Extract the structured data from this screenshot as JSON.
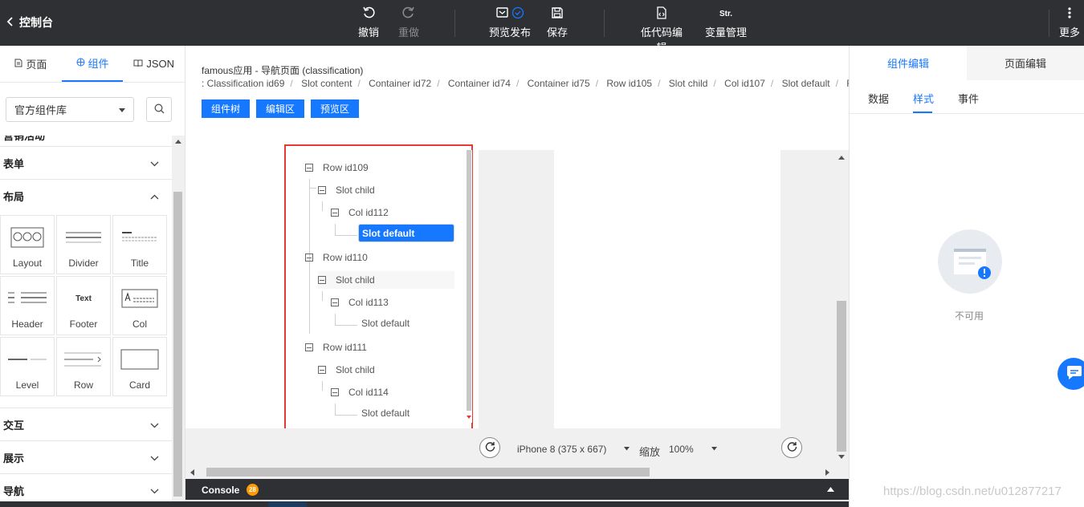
{
  "topbar": {
    "back_label": "控制台",
    "undo": "撤销",
    "redo": "重做",
    "preview_publish": "预览发布",
    "save": "保存",
    "lowcode": "低代码编辑",
    "variables": "变量管理",
    "variables_icon_text": "Str.",
    "more": "更多"
  },
  "left": {
    "tabs": {
      "page": "页面",
      "components": "组件",
      "json": "JSON"
    },
    "library_select": "官方组件库",
    "partial_group": "营销活动",
    "groups": {
      "form": "表单",
      "layout": "布局",
      "interaction": "交互",
      "display": "展示",
      "navigation": "导航"
    },
    "components": [
      "Layout",
      "Divider",
      "Title",
      "Header",
      "Footer",
      "Col",
      "Level",
      "Row",
      "Card"
    ],
    "footer_thumb_text": "Text"
  },
  "center": {
    "page_title": "famous应用 - 导航页面 (classification)",
    "breadcrumb": [
      ": Classification id69",
      "Slot content",
      "Container id72",
      "Container id74",
      "Container id75",
      "Row id105",
      "Slot child",
      "Col id107",
      "Slot default",
      "R"
    ],
    "buttons": {
      "tree": "组件树",
      "edit": "编辑区",
      "preview": "预览区"
    },
    "tree": {
      "rows": [
        "Row id109",
        "Row id110",
        "Row id111"
      ],
      "slot_child": "Slot child",
      "cols": [
        "Col id112",
        "Col id113",
        "Col id114"
      ],
      "slot_default": "Slot default"
    },
    "device": "iPhone 8 (375 x 667)",
    "zoom_label": "缩放",
    "zoom_value": "100%"
  },
  "console": {
    "label": "Console",
    "count": "28"
  },
  "right": {
    "tabs": {
      "component_edit": "组件编辑",
      "page_edit": "页面编辑"
    },
    "subtabs": {
      "data": "数据",
      "style": "样式",
      "events": "事件"
    },
    "empty_text": "不可用"
  },
  "watermark": "https://blog.csdn.net/u012877217",
  "colors": {
    "accent": "#1677ff",
    "topbar": "#2e3033",
    "highlight": "#e53935",
    "badge": "#ff9900"
  }
}
